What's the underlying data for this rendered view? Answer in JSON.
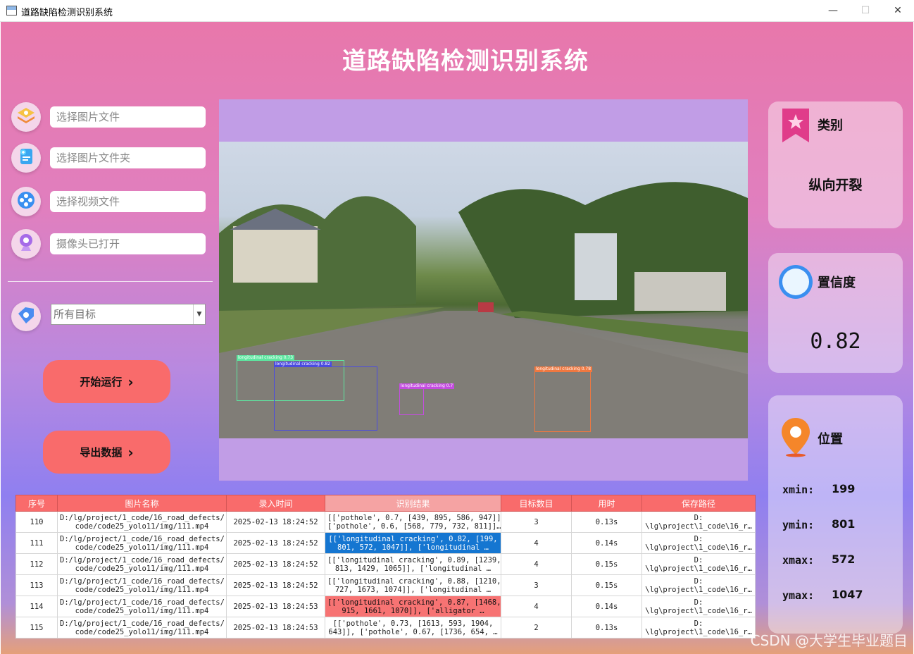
{
  "window": {
    "title": "道路缺陷检测识别系统",
    "minimize": "—",
    "maximize": "☐",
    "close": "✕"
  },
  "header": {
    "title": "道路缺陷检测识别系统"
  },
  "left_panel": {
    "image_file": "选择图片文件",
    "image_folder": "选择图片文件夹",
    "video_file": "选择视频文件",
    "camera": "摄像头已打开",
    "target_select": "所有目标",
    "start_button": "开始运行",
    "export_button": "导出数据",
    "chevron": "›"
  },
  "detections": [
    {
      "label": "longitudinal cracking 0.73",
      "color": "#5ee6a0"
    },
    {
      "label": "longitudinal cracking 0.82",
      "color": "#4b4be0"
    },
    {
      "label": "longitudinal cracking 0.7",
      "color": "#c44ce0"
    },
    {
      "label": "longitudinal cracking 0.78",
      "color": "#f07840"
    }
  ],
  "result_panel": {
    "class_title": "类别",
    "class_value": "纵向开裂",
    "conf_title": "置信度",
    "conf_value": "0.82",
    "pos_title": "位置",
    "xmin_label": "xmin:",
    "xmin": "199",
    "ymin_label": "ymin:",
    "ymin": "801",
    "xmax_label": "xmax:",
    "xmax": "572",
    "ymax_label": "ymax:",
    "ymax": "1047"
  },
  "table": {
    "headers": [
      "序号",
      "图片名称",
      "录入时间",
      "识别结果",
      "目标数目",
      "用时",
      "保存路径"
    ],
    "rows": [
      {
        "id": "110",
        "name1": "D:/lg/project/1_code/16_road_defects/",
        "name2": "code/code25_yolo11/img/111.mp4",
        "time": "2025-02-13 18:24:52",
        "res1": "[['pothole', 0.7, [439, 895, 586, 947]],",
        "res2": "['pothole', 0.6, [568, 779, 732, 811]]…",
        "count": "3",
        "dur": "0.13s",
        "path1": "D:",
        "path2": "\\lg\\project\\1_code\\16_r…"
      },
      {
        "id": "111",
        "name1": "D:/lg/project/1_code/16_road_defects/",
        "name2": "code/code25_yolo11/img/111.mp4",
        "time": "2025-02-13 18:24:52",
        "res1": "[['longitudinal cracking', 0.82, [199,",
        "res2": "801, 572, 1047]], ['longitudinal …",
        "count": "4",
        "dur": "0.14s",
        "path1": "D:",
        "path2": "\\lg\\project\\1_code\\16_r…"
      },
      {
        "id": "112",
        "name1": "D:/lg/project/1_code/16_road_defects/",
        "name2": "code/code25_yolo11/img/111.mp4",
        "time": "2025-02-13 18:24:52",
        "res1": "[['longitudinal cracking', 0.89, [1239,",
        "res2": "813, 1429, 1065]], ['longitudinal …",
        "count": "4",
        "dur": "0.15s",
        "path1": "D:",
        "path2": "\\lg\\project\\1_code\\16_r…"
      },
      {
        "id": "113",
        "name1": "D:/lg/project/1_code/16_road_defects/",
        "name2": "code/code25_yolo11/img/111.mp4",
        "time": "2025-02-13 18:24:52",
        "res1": "[['longitudinal cracking', 0.88, [1210,",
        "res2": "727, 1673, 1074]], ['longitudinal …",
        "count": "3",
        "dur": "0.15s",
        "path1": "D:",
        "path2": "\\lg\\project\\1_code\\16_r…"
      },
      {
        "id": "114",
        "name1": "D:/lg/project/1_code/16_road_defects/",
        "name2": "code/code25_yolo11/img/111.mp4",
        "time": "2025-02-13 18:24:53",
        "res1": "[['longitudinal cracking', 0.87, [1468,",
        "res2": "915, 1661, 1070]], ['alligator …",
        "count": "4",
        "dur": "0.14s",
        "path1": "D:",
        "path2": "\\lg\\project\\1_code\\16_r…"
      },
      {
        "id": "115",
        "name1": "D:/lg/project/1_code/16_road_defects/",
        "name2": "code/code25_yolo11/img/111.mp4",
        "time": "2025-02-13 18:24:53",
        "res1": "[['pothole', 0.73, [1613, 593, 1904,",
        "res2": "643]], ['pothole', 0.67, [1736, 654, …",
        "count": "2",
        "dur": "0.13s",
        "path1": "D:",
        "path2": "\\lg\\project\\1_code\\16_r…"
      }
    ]
  },
  "watermark": "CSDN @大学生毕业题目"
}
